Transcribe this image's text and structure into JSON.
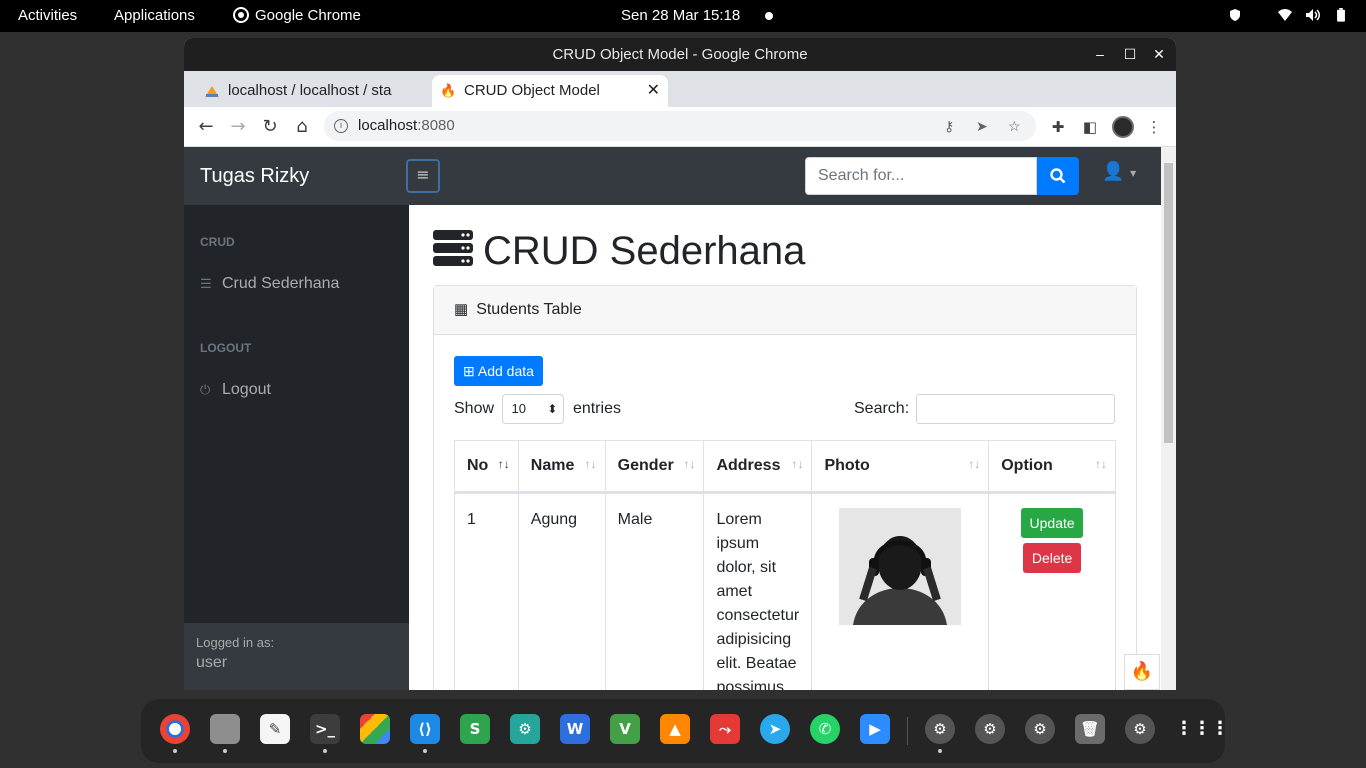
{
  "topbar": {
    "activities": "Activities",
    "applications": "Applications",
    "app_name": "Google Chrome",
    "clock": "Sen 28 Mar  15:18"
  },
  "browser": {
    "window_title": "CRUD Object Model - Google Chrome",
    "tabs": [
      {
        "label": "localhost / localhost / sta"
      },
      {
        "label": "CRUD Object Model"
      }
    ],
    "url_host": "localhost",
    "url_port": ":8080"
  },
  "app": {
    "brand": "Tugas Rizky",
    "search_placeholder": "Search for...",
    "sidebar": {
      "section1": "CRUD",
      "item1": "Crud Sederhana",
      "section2": "LOGOUT",
      "item2": "Logout",
      "footer_label": "Logged in as:",
      "footer_user": "user"
    },
    "page_title": "CRUD Sederhana",
    "card_title": "Students Table",
    "add_button": "Add data",
    "show_label": "Show",
    "show_value": "10",
    "entries_label": "entries",
    "search_label": "Search:",
    "table": {
      "headers": [
        "No",
        "Name",
        "Gender",
        "Address",
        "Photo",
        "Option"
      ],
      "rows": [
        {
          "no": "1",
          "name": "Agung",
          "gender": "Male",
          "address": "Lorem ipsum dolor, sit amet consectetur adipisicing elit. Beatae possimus,"
        }
      ]
    },
    "update_button": "Update",
    "delete_button": "Delete"
  },
  "colors": {
    "primary": "#007bff",
    "success": "#28a745",
    "danger": "#dc3545",
    "navbar": "#343a40",
    "sidebar": "#212529"
  }
}
